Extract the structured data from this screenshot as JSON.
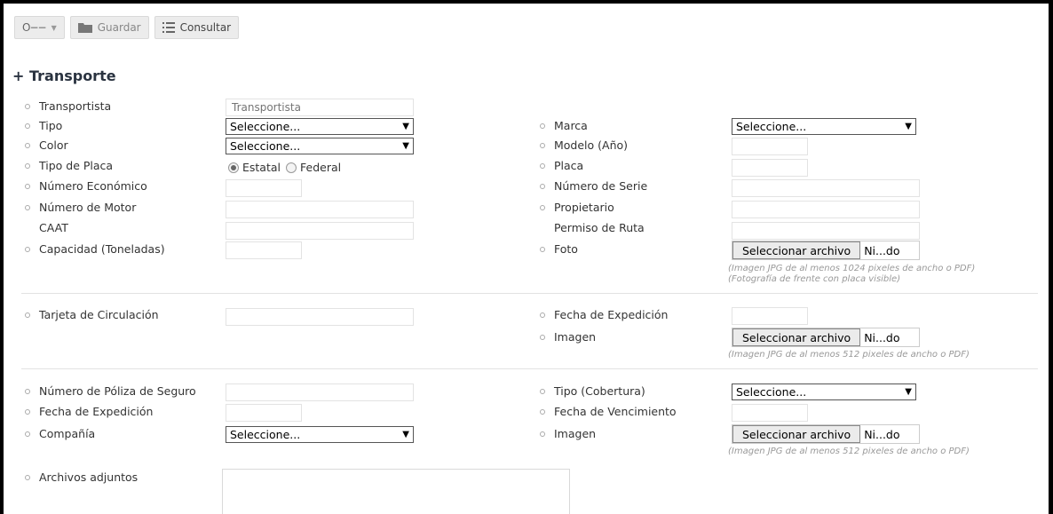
{
  "toolbar": {
    "key_icon_text": "O−−",
    "save_label": "Guardar",
    "consult_label": "Consultar"
  },
  "section": {
    "title": "+ Transporte"
  },
  "left": {
    "transportista": {
      "label": "Transportista",
      "placeholder": "Transportista"
    },
    "tipo": {
      "label": "Tipo",
      "value": "Seleccione..."
    },
    "color": {
      "label": "Color",
      "value": "Seleccione..."
    },
    "tipo_placa": {
      "label": "Tipo de Placa",
      "option1": "Estatal",
      "option2": "Federal",
      "selected": "Estatal"
    },
    "numero_economico": {
      "label": "Número Económico"
    },
    "numero_motor": {
      "label": "Número de Motor"
    },
    "caat": {
      "label": "CAAT"
    },
    "capacidad": {
      "label": "Capacidad (Toneladas)"
    },
    "tarjeta": {
      "label": "Tarjeta de Circulación"
    },
    "poliza": {
      "label": "Número de Póliza de Seguro"
    },
    "fecha_exp_poliza": {
      "label": "Fecha de Expedición"
    },
    "compania": {
      "label": "Compañía",
      "value": "Seleccione..."
    },
    "adjuntos": {
      "label": "Archivos adjuntos"
    }
  },
  "right": {
    "marca": {
      "label": "Marca",
      "value": "Seleccione..."
    },
    "modelo": {
      "label": "Modelo (Año)"
    },
    "placa": {
      "label": "Placa"
    },
    "serie": {
      "label": "Número de Serie"
    },
    "propietario": {
      "label": "Propietario"
    },
    "permiso": {
      "label": "Permiso de Ruta"
    },
    "foto": {
      "label": "Foto",
      "button": "Seleccionar archivo",
      "file": "Ni...do",
      "hint1": "(Imagen JPG de al menos 1024 pixeles de ancho o PDF)",
      "hint2": "(Fotografía de frente con placa visible)"
    },
    "fecha_expedicion": {
      "label": "Fecha de Expedición"
    },
    "imagen_tarjeta": {
      "label": "Imagen",
      "button": "Seleccionar archivo",
      "file": "Ni...do",
      "hint": "(Imagen JPG de al menos 512 pixeles de ancho o PDF)"
    },
    "tipo_cobertura": {
      "label": "Tipo (Cobertura)",
      "value": "Seleccione..."
    },
    "fecha_vencimiento": {
      "label": "Fecha de Vencimiento"
    },
    "imagen_poliza": {
      "label": "Imagen",
      "button": "Seleccionar archivo",
      "file": "Ni...do",
      "hint": "(Imagen JPG de al menos 512 pixeles de ancho o PDF)"
    }
  }
}
